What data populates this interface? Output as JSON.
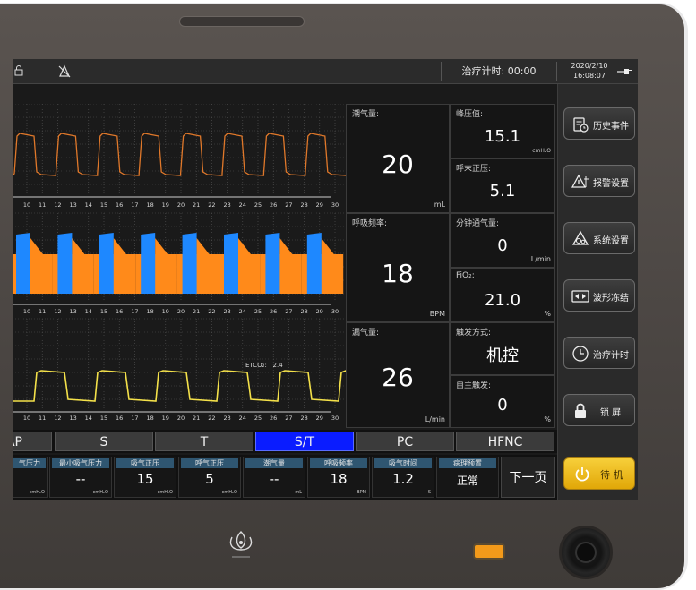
{
  "topbar": {
    "timer_label": "治疗计时: 00:00",
    "date": "2020/2/10",
    "time": "16:08:07"
  },
  "waveforms": {
    "x_ticks": [
      "10",
      "11",
      "12",
      "13",
      "14",
      "15",
      "16",
      "17",
      "18",
      "19",
      "20",
      "21",
      "22",
      "23",
      "24",
      "25",
      "26",
      "27",
      "28",
      "29",
      "30"
    ],
    "etco2_label": "ETCO₂:",
    "etco2_value": "2.4",
    "colors": {
      "pressure": "#e0782a",
      "flow_fill": "#ff8a1a",
      "flow_peak": "#1e88ff",
      "volume": "#f4e14a",
      "grid": "#555555"
    }
  },
  "params_large": [
    {
      "label": "潮气量:",
      "value": "20",
      "unit": "mL"
    },
    {
      "label": "呼吸频率:",
      "value": "18",
      "unit": "BPM"
    },
    {
      "label": "漏气量:",
      "value": "26",
      "unit": "L/min"
    }
  ],
  "params_small": [
    {
      "label": "峰压值:",
      "value": "15.1",
      "unit": "cmH₂O"
    },
    {
      "label": "呼末正压:",
      "value": "5.1",
      "unit": ""
    },
    {
      "label": "分钟通气量:",
      "value": "0",
      "unit": "L/min"
    },
    {
      "label": "FiO₂:",
      "value": "21.0",
      "unit": "%"
    },
    {
      "label": "触发方式:",
      "value": "机控",
      "unit": ""
    },
    {
      "label": "自主触发:",
      "value": "0",
      "unit": "%"
    }
  ],
  "side_menu": [
    {
      "label": "历史事件",
      "icon": "history-clipboard-icon"
    },
    {
      "label": "报警设置",
      "icon": "alarm-settings-icon"
    },
    {
      "label": "系统设置",
      "icon": "system-settings-icon"
    },
    {
      "label": "波形冻结",
      "icon": "waveform-freeze-icon"
    },
    {
      "label": "治疗计时",
      "icon": "timer-clock-icon"
    },
    {
      "label": "锁  屏",
      "icon": "lock-icon"
    }
  ],
  "standby_label": "待 机",
  "modes": [
    {
      "label": "AP",
      "active": false
    },
    {
      "label": "S",
      "active": false
    },
    {
      "label": "T",
      "active": false
    },
    {
      "label": "S/T",
      "active": true
    },
    {
      "label": "PC",
      "active": false
    },
    {
      "label": "HFNC",
      "active": false
    }
  ],
  "settings": [
    {
      "label": "气压力",
      "value": "-",
      "unit": "cmH₂O"
    },
    {
      "label": "最小吸气压力",
      "value": "--",
      "unit": "cmH₂O"
    },
    {
      "label": "吸气正压",
      "value": "15",
      "unit": "cmH₂O"
    },
    {
      "label": "呼气正压",
      "value": "5",
      "unit": "cmH₂O"
    },
    {
      "label": "潮气量",
      "value": "--",
      "unit": "mL"
    },
    {
      "label": "呼吸频率",
      "value": "18",
      "unit": "BPM"
    },
    {
      "label": "吸气时间",
      "value": "1.2",
      "unit": "S"
    },
    {
      "label": "病理预置",
      "value": "正常",
      "unit": ""
    }
  ],
  "next_page_label": "下一页"
}
